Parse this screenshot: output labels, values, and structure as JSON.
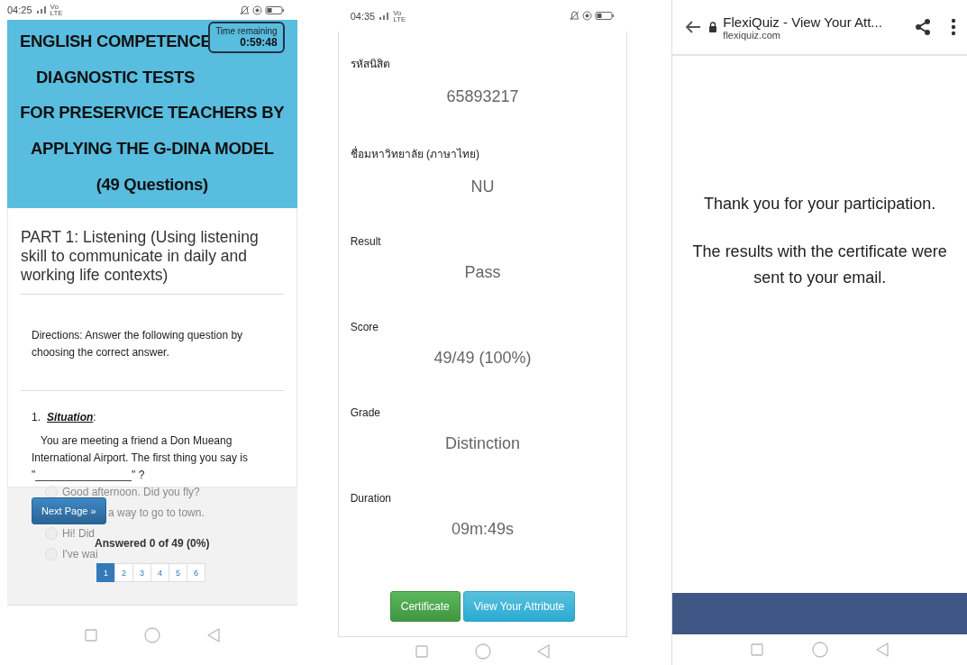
{
  "quiz_screen": {
    "status_bar": {
      "time": "04:25",
      "network_label": "Vo LTE"
    },
    "header": {
      "title_lines": [
        "ENGLISH COMPETENCE",
        "DIAGNOSTIC TESTS",
        "FOR PRESERVICE TEACHERS BY",
        "APPLYING THE G-DINA MODEL",
        "(49 Questions)"
      ],
      "timer": {
        "label": "Time remaining",
        "value": "0:59:48"
      }
    },
    "part_title": "PART 1: Listening (Using listening skill to communicate in daily and working life contexts)",
    "directions": "Directions: Answer the following question by choosing the correct answer.",
    "question": {
      "number": "1.",
      "label": "**Situation**:",
      "text": "You are meeting a friend a Don Mueang International Airport. The first thing you say is \"________________\" ?",
      "options": [
        {
          "text": "Good afternoon. Did you fly?",
          "selected": false
        },
        {
          "text": "a way to go to town."
        },
        {
          "text": "Hi! Did",
          "selected": false
        },
        {
          "text": "I've wai",
          "selected": false
        }
      ]
    },
    "next_button": "Next Page »",
    "progress": "Answered 0 of 49 (0%)",
    "pages": [
      {
        "label": "1",
        "selected": true
      },
      {
        "label": "2",
        "selected": false
      },
      {
        "label": "3",
        "selected": false
      },
      {
        "label": "4",
        "selected": false
      },
      {
        "label": "5",
        "selected": false
      },
      {
        "label": "6",
        "selected": false
      }
    ]
  },
  "result_screen": {
    "status_bar": {
      "time": "04:35",
      "network_label": "Vo LTE"
    },
    "fields": [
      {
        "label": "รหัสนิสิต",
        "value": "65893217"
      },
      {
        "label": "ชื่อมหาวิทยาลัย (ภาษาไทย)",
        "value": "NU"
      },
      {
        "label": "Result",
        "value": "Pass"
      },
      {
        "label": "Score",
        "value": "49/49 (100%)"
      },
      {
        "label": "Grade",
        "value": "Distinction"
      },
      {
        "label": "Duration",
        "value": "09m:49s"
      }
    ],
    "buttons": [
      {
        "label": "Certificate",
        "kind": "success"
      },
      {
        "label": "View Your Attribute",
        "kind": "info"
      }
    ]
  },
  "browser_screen": {
    "page_title": "FlexiQuiz - View Your Att...",
    "url": "flexiquiz.com",
    "messages": [
      "Thank you for your participation.",
      "The results with the certificate were sent to your email."
    ]
  }
}
